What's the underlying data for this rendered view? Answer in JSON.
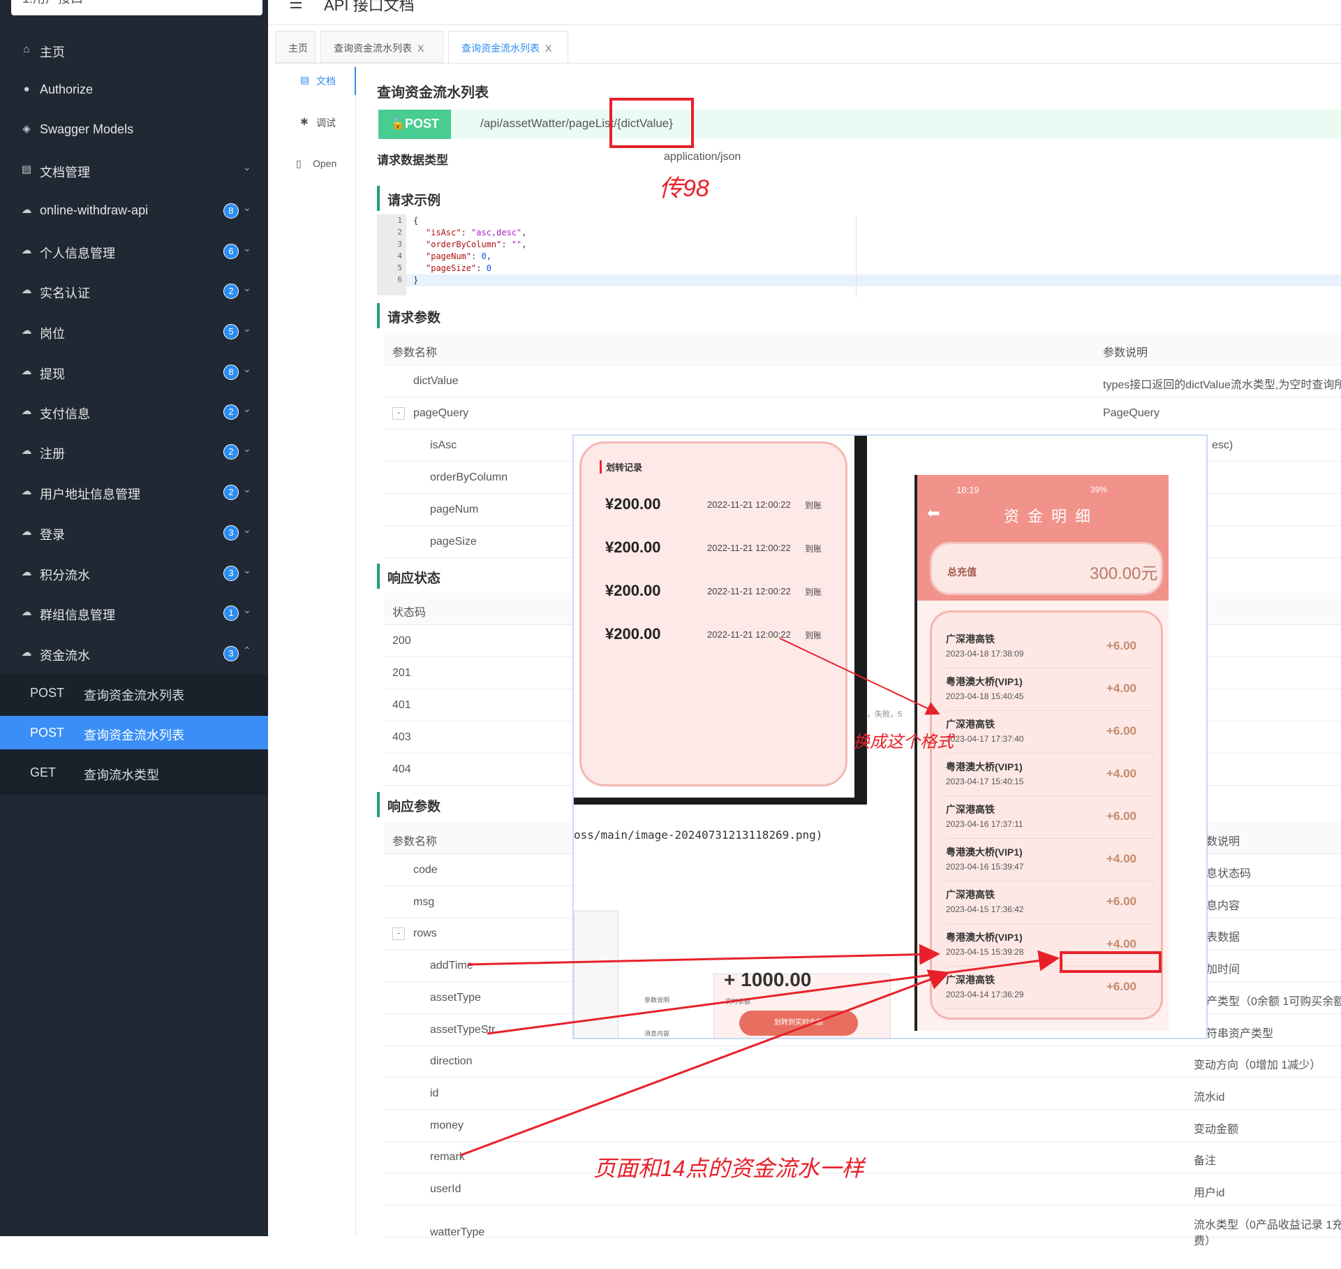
{
  "sidebar": {
    "group_select": "1.用户接口",
    "items": [
      {
        "icon": "home-icon",
        "glyph": "⌂",
        "label": "主页"
      },
      {
        "icon": "lock-icon",
        "glyph": "●",
        "label": "Authorize"
      },
      {
        "icon": "cube-icon",
        "glyph": "◈",
        "label": "Swagger Models"
      },
      {
        "icon": "document-icon",
        "glyph": "▤",
        "label": "文档管理"
      },
      {
        "icon": "cloud-icon",
        "glyph": "☁",
        "label": "online-withdraw-api",
        "badge": "8"
      },
      {
        "icon": "cloud-icon",
        "glyph": "☁",
        "label": "个人信息管理",
        "badge": "6"
      },
      {
        "icon": "cloud-icon",
        "glyph": "☁",
        "label": "实名认证",
        "badge": "2"
      },
      {
        "icon": "cloud-icon",
        "glyph": "☁",
        "label": "岗位",
        "badge": "5"
      },
      {
        "icon": "cloud-icon",
        "glyph": "☁",
        "label": "提现",
        "badge": "8"
      },
      {
        "icon": "cloud-icon",
        "glyph": "☁",
        "label": "支付信息",
        "badge": "2"
      },
      {
        "icon": "cloud-icon",
        "glyph": "☁",
        "label": "注册",
        "badge": "2"
      },
      {
        "icon": "cloud-icon",
        "glyph": "☁",
        "label": "用户地址信息管理",
        "badge": "2"
      },
      {
        "icon": "cloud-icon",
        "glyph": "☁",
        "label": "登录",
        "badge": "3"
      },
      {
        "icon": "cloud-icon",
        "glyph": "☁",
        "label": "积分流水",
        "badge": "3"
      },
      {
        "icon": "cloud-icon",
        "glyph": "☁",
        "label": "群组信息管理",
        "badge": "1"
      },
      {
        "icon": "cloud-icon",
        "glyph": "☁",
        "label": "资金流水",
        "badge": "3"
      }
    ],
    "sub_items": [
      {
        "method": "POST",
        "label": "查询资金流水列表"
      },
      {
        "method": "POST",
        "label": "查询资金流水列表"
      },
      {
        "method": "GET",
        "label": "查询流水类型"
      }
    ]
  },
  "header": {
    "title": "API 接口文档"
  },
  "tabs": [
    {
      "label": "主页"
    },
    {
      "label": "查询资金流水列表"
    },
    {
      "label": "查询资金流水列表"
    }
  ],
  "vnav": {
    "doc": "文档",
    "debug": "调试",
    "open": "Open"
  },
  "doc": {
    "title": "查询资金流水列表",
    "method": "POST",
    "url": "/api/assetWatter/pageList/{dictValue}",
    "req_type_label": "请求数据类型",
    "req_type_value": "application/json",
    "sections": {
      "example": "请求示例",
      "params": "请求参数",
      "status": "响应状态",
      "resp": "响应参数"
    },
    "code_lines": [
      "1",
      "2",
      "3",
      "4",
      "5",
      "6"
    ],
    "params_head": [
      "参数名称",
      "参数说明"
    ],
    "params": [
      {
        "name": "dictValue",
        "desc": "types接口返回的dictValue流水类型,为空时查询所有"
      },
      {
        "name": "pageQuery",
        "desc": "PageQuery"
      },
      {
        "name": "isAsc",
        "desc": "esc)"
      },
      {
        "name": "orderByColumn",
        "desc": ""
      },
      {
        "name": "pageNum",
        "desc": ""
      },
      {
        "name": "pageSize",
        "desc": ""
      }
    ],
    "status_head": "状态码",
    "status_codes": [
      "200",
      "201",
      "401",
      "403",
      "404"
    ],
    "resp_head": [
      "参数名称",
      "数说明"
    ],
    "resp": [
      {
        "name": "code",
        "desc": "息状态码"
      },
      {
        "name": "msg",
        "desc": "息内容"
      },
      {
        "name": "rows",
        "desc": "表数据"
      },
      {
        "name": "addTime",
        "desc": "加时间"
      },
      {
        "name": "assetType",
        "desc": "产类型（0余额 1可购买余额"
      },
      {
        "name": "assetTypeStr",
        "desc": "符串资产类型"
      },
      {
        "name": "direction",
        "desc": "变动方向（0增加 1减少）"
      },
      {
        "name": "id",
        "desc": "流水id"
      },
      {
        "name": "money",
        "desc": "变动金额"
      },
      {
        "name": "remark",
        "desc": "备注"
      },
      {
        "name": "userId",
        "desc": "用户id"
      },
      {
        "name": "watterType",
        "desc": "流水类型（0产品收益记录 1充"
      },
      {
        "name": "",
        "desc": "费）"
      }
    ]
  },
  "overlay": {
    "card_title": "划转记录",
    "records": [
      {
        "amount": "¥200.00",
        "date": "2022-11-21 12:00:22",
        "status": "到账"
      },
      {
        "amount": "¥200.00",
        "date": "2022-11-21 12:00:22",
        "status": "到账"
      },
      {
        "amount": "¥200.00",
        "date": "2022-11-21 12:00:22",
        "status": "到账"
      },
      {
        "amount": "¥200.00",
        "date": "2022-11-21 12:00:22",
        "status": "到账"
      }
    ],
    "path_text": "oss/main/image-20240731213118269.png)",
    "fail_text": "，失败，5",
    "mini_amount": "+ 1000.00",
    "mini_labels": [
      "参数说明",
      "消息内容"
    ],
    "mini_sub": "实时余额",
    "mini_button": "划转到实时余额",
    "phone": {
      "time": "18:19",
      "battery": "39%",
      "title": "资金明细",
      "sum_label": "总充值",
      "sum_value": "300.00元",
      "rows": [
        {
          "name": "广深港高铁",
          "date": "2023-04-18 17:38:09",
          "amount": "+6.00"
        },
        {
          "name": "粤港澳大桥(VIP1)",
          "date": "2023-04-18 15:40:45",
          "amount": "+4.00"
        },
        {
          "name": "广深港高铁",
          "date": "2023-04-17 17:37:40",
          "amount": "+6.00"
        },
        {
          "name": "粤港澳大桥(VIP1)",
          "date": "2023-04-17 15:40:15",
          "amount": "+4.00"
        },
        {
          "name": "广深港高铁",
          "date": "2023-04-16 17:37:11",
          "amount": "+6.00"
        },
        {
          "name": "粤港澳大桥(VIP1)",
          "date": "2023-04-16 15:39:47",
          "amount": "+4.00"
        },
        {
          "name": "广深港高铁",
          "date": "2023-04-15 17:36:42",
          "amount": "+6.00"
        },
        {
          "name": "粤港澳大桥(VIP1)",
          "date": "2023-04-15 15:39:28",
          "amount": "+4.00"
        },
        {
          "name": "广深港高铁",
          "date": "2023-04-14 17:36:29",
          "amount": "+6.00"
        }
      ]
    }
  },
  "annotations": {
    "note1": "传98",
    "note2": "换成这个格式",
    "note3": "页面和14点的资金流水一样",
    "color": "#e8202a"
  }
}
